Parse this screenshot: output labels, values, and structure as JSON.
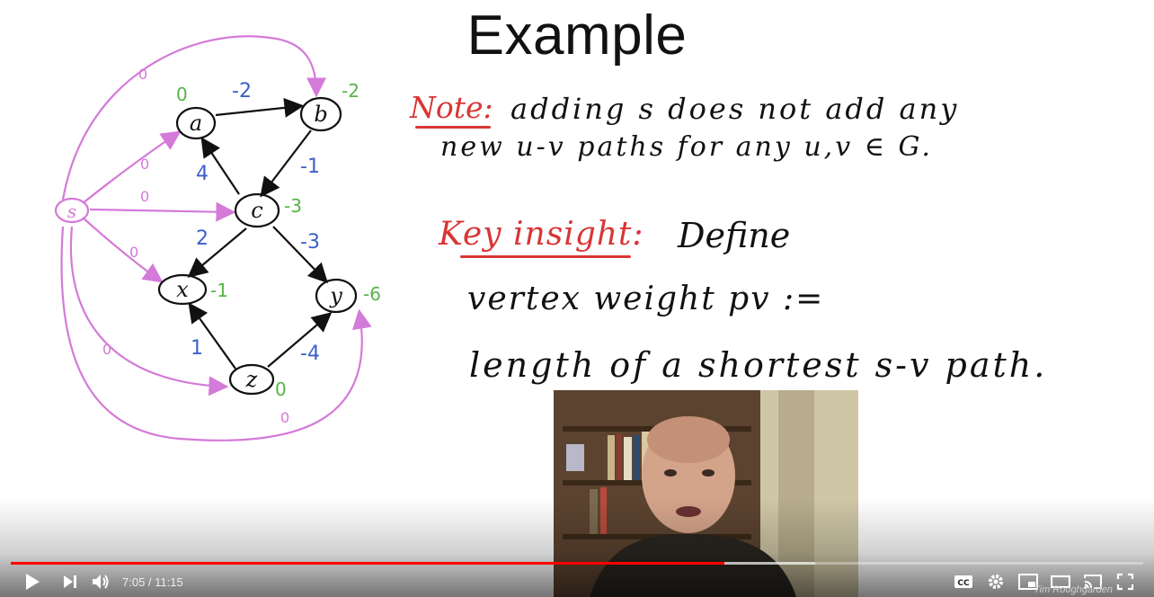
{
  "slide": {
    "title": "Example",
    "note_label": "Note:",
    "note_line1": "adding s does not add any",
    "note_line2": "new u-v paths for any u,v ∈ G.",
    "key_label": "Key insight:",
    "key_text": "Define",
    "definition_line1": "vertex weight pv :=",
    "definition_line2": "length of a shortest s-v path."
  },
  "graph": {
    "nodes": [
      "s",
      "a",
      "b",
      "c",
      "x",
      "y",
      "z"
    ],
    "edge_weights": [
      "-2",
      "4",
      "-1",
      "2",
      "-3",
      "1",
      "-4"
    ],
    "s_edge_weights": [
      "0",
      "0",
      "0",
      "0",
      "0",
      "0"
    ],
    "vertex_weights": {
      "a": "0",
      "b": "-2",
      "c": "-3",
      "x": "-1",
      "y": "-6",
      "z": "0"
    }
  },
  "player": {
    "current_time": "7:05",
    "duration": "11:15",
    "time_display": "7:05 / 11:15",
    "played_fraction": 0.63,
    "loaded_fraction": 0.71,
    "watermark": "Tim Roughgarden"
  },
  "colors": {
    "progress_played": "#ff0000",
    "red_ink": "#d93535",
    "blue_ink": "#3b5fc8",
    "green_ink": "#55b545",
    "magenta_ink": "#d47ad8"
  },
  "icons": [
    "play-icon",
    "next-icon",
    "volume-icon",
    "captions-icon",
    "settings-icon",
    "miniplayer-icon",
    "theater-icon",
    "cast-icon",
    "fullscreen-icon"
  ]
}
